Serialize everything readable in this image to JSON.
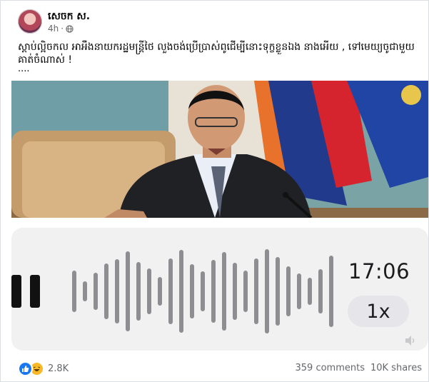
{
  "post": {
    "author": "សេចក ស.",
    "time": "4h",
    "privacy_icon": "globe-icon",
    "text": "ស្តាប់ល្អិចកល អាអឺងនាយករដ្ឋមន្រ្តីថៃ លួងចង់ប្រើប្រាស់ពូជើម្បីនោះទុក្ខខ្លួនឯង នាងអើយ , ទៅមេយ្យចូជាមួយគាត់ចំណាស់ !",
    "more": "...."
  },
  "voice_message": {
    "play_state_icon": "pause-icon",
    "duration": "17:06",
    "speed": "1x",
    "volume_icon": "volume-icon"
  },
  "footer": {
    "reactions": [
      "like-icon",
      "haha-icon"
    ],
    "reaction_count": "2.8K",
    "comments": "359 comments",
    "shares": "10K shares"
  },
  "colors": {
    "like": "#1877f2",
    "haha": "#f7b928",
    "waveform": "#8e8e92",
    "voice_bg": "#f1f1f2"
  }
}
